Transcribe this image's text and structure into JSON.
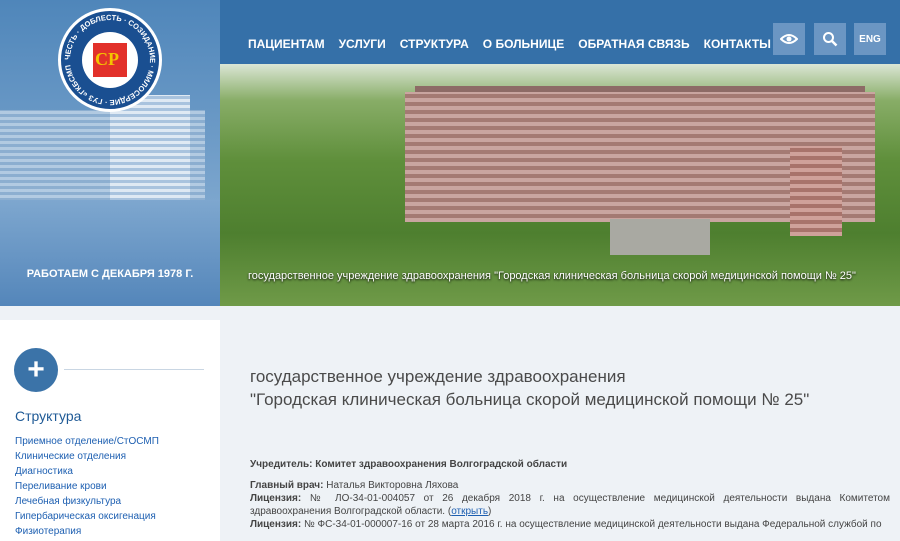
{
  "brand": {
    "logo_text": "ЧЕСТЬ · ДОБЛЕСТЬ · СОЗИДАНИЕ · МИЛОСЕРДИЕ · ГУЗ «ГКБСМП № 25»",
    "logo_letters": "СР",
    "since": "РАБОТАЕМ С ДЕКАБРЯ 1978 Г."
  },
  "nav": {
    "items": [
      "ПАЦИЕНТАМ",
      "УСЛУГИ",
      "СТРУКТУРА",
      "О БОЛЬНИЦЕ",
      "ОБРАТНАЯ СВЯЗЬ",
      "КОНТАКТЫ"
    ],
    "lang": "ENG"
  },
  "hero": {
    "caption": "государственное учреждение здравоохранения \"Городская клиническая больница скорой медицинской помощи № 25\""
  },
  "sidebar": {
    "title": "Структура",
    "items": [
      "Приемное отделение/СтОСМП",
      "Клинические отделения",
      "Диагностика",
      "Переливание крови",
      "Лечебная физкультура",
      "Гипербарическая оксигенация",
      "Физиотерапия"
    ]
  },
  "main": {
    "title_line1": "государственное учреждение здравоохранения",
    "title_line2": "\"Городская клиническая больница скорой медицинской помощи № 25\"",
    "founder": "Учредитель: Комитет здравоохранения Волгоградской области",
    "chief_label": "Главный врач:",
    "chief_name": "Наталья Викторовна Ляхова",
    "license1_label": "Лицензия:",
    "license1_text": "№ ЛО-34-01-004057 от 26 декабря 2018 г. на осуществление медицинской деятельности выдана Комитетом здравоохранения Волгоградской области.",
    "license1_link": "открыть",
    "license2_label": "Лицензия:",
    "license2_text": "№ ФС-34-01-000007-16 от 28 марта 2016 г. на осуществление медицинской деятельности выдана Федеральной службой по"
  }
}
